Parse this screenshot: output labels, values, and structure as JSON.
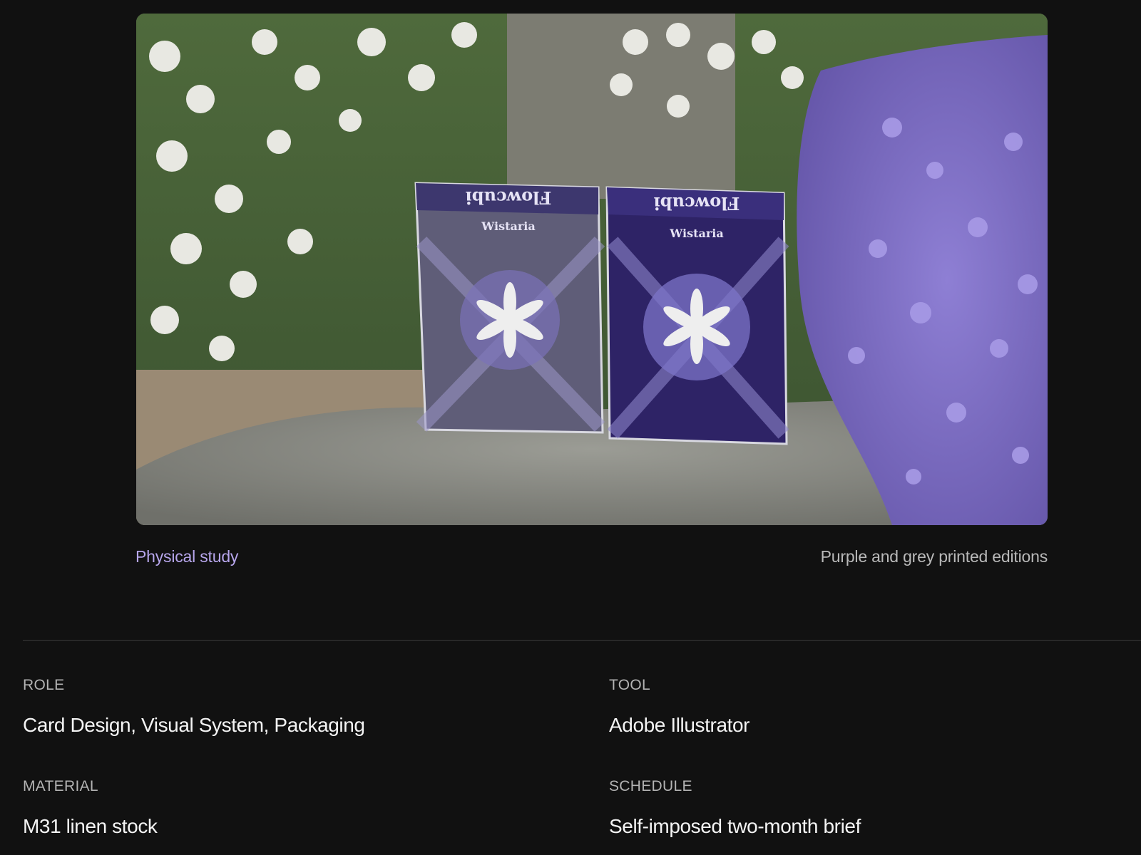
{
  "figure": {
    "photo": {
      "deck_grey": {
        "brand": "Flowcubi",
        "name": "Wistaria"
      },
      "deck_purple": {
        "brand": "Flowcubi",
        "name": "Wistaria"
      }
    },
    "caption_label": "Physical study",
    "caption_text": "Purple and grey printed editions"
  },
  "details": {
    "role": {
      "label": "ROLE",
      "value": "Card Design, Visual System, Packaging"
    },
    "tool": {
      "label": "TOOL",
      "value": "Adobe Illustrator"
    },
    "material": {
      "label": "MATERIAL",
      "value": "M31 linen stock"
    },
    "schedule": {
      "label": "SCHEDULE",
      "value": "Self-imposed two-month brief"
    }
  },
  "colors": {
    "background": "#111111",
    "accent_caption": "#b7a6ec",
    "deck_purple": "#2e2366",
    "deck_grey": "#5f5d78"
  }
}
